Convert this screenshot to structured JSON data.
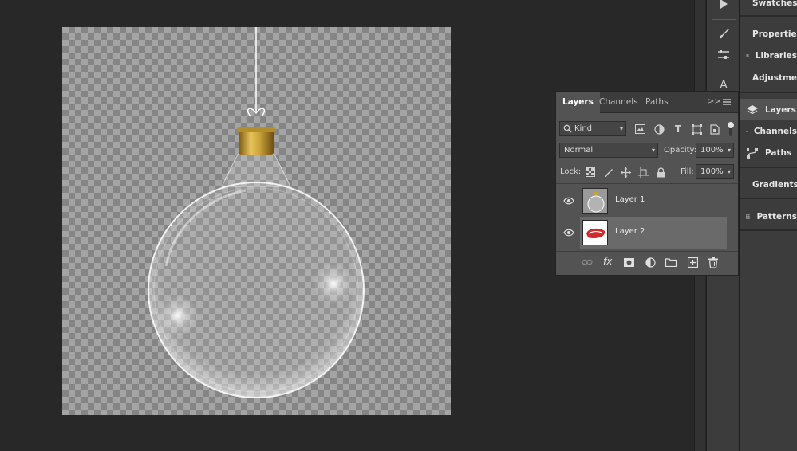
{
  "panel": {
    "tabs": [
      {
        "label": "Layers"
      },
      {
        "label": "Channels"
      },
      {
        "label": "Paths"
      }
    ],
    "collapse_glyph": ">>",
    "filter": {
      "label": "Kind"
    },
    "blend_mode": "Normal",
    "opacity_label": "Opacity:",
    "opacity_value": "100%",
    "lock_label": "Lock:",
    "fill_label": "Fill:",
    "fill_value": "100%",
    "layers": [
      {
        "name": "Layer 1",
        "visible": true,
        "selected": false
      },
      {
        "name": "Layer 2",
        "visible": true,
        "selected": true
      }
    ],
    "footer_fx": "fx"
  },
  "dock": {
    "items": [
      {
        "label": "Swatches",
        "icon": "grid-icon"
      },
      {
        "label": "Properties",
        "icon": "sliders-icon"
      },
      {
        "label": "Libraries",
        "icon": "library-icon"
      },
      {
        "label": "Adjustments",
        "icon": "half-circle-icon"
      },
      {
        "label": "Layers",
        "icon": "layers-icon",
        "active": true
      },
      {
        "label": "Channels",
        "icon": "channels-icon"
      },
      {
        "label": "Paths",
        "icon": "pen-path-icon"
      },
      {
        "label": "Gradients",
        "icon": "gradient-icon"
      },
      {
        "label": "Patterns",
        "icon": "grid-icon"
      }
    ]
  },
  "icon_column": {
    "items": [
      "play-icon",
      "brush-icon",
      "sliders-icon",
      "type-icon"
    ],
    "letter": "A"
  },
  "colors": {
    "workspace": "#282828",
    "panel": "#535353",
    "selection": "#6a6a6a",
    "cap_gold": "#c9a23a"
  }
}
